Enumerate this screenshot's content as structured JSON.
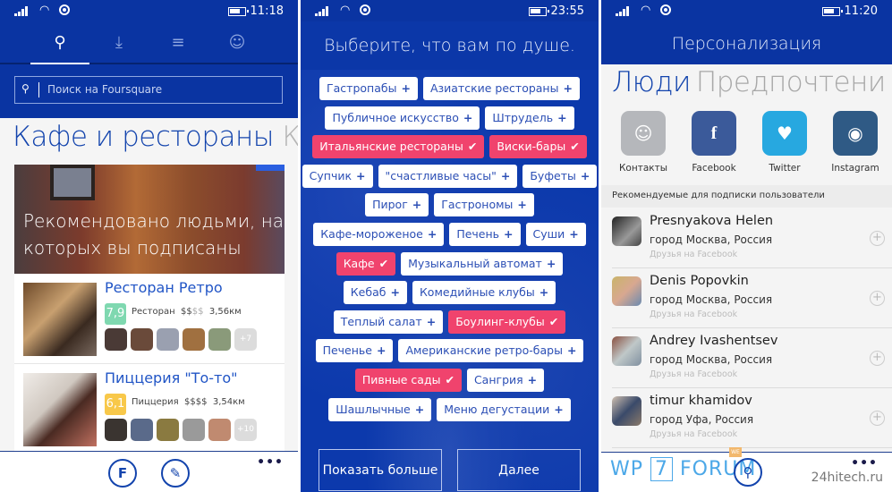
{
  "screen1": {
    "status": {
      "time": "11:18"
    },
    "tabs": [
      {
        "icon": "search-icon",
        "glyph": "⚲",
        "selected": true
      },
      {
        "icon": "download-icon",
        "glyph": "⤓",
        "selected": false
      },
      {
        "icon": "lists-icon",
        "glyph": "≡",
        "selected": false
      },
      {
        "icon": "profile-icon",
        "glyph": "☺",
        "selected": false
      }
    ],
    "search": {
      "placeholder": "Поиск на Foursquare"
    },
    "section_title": "Кафе и рестораны",
    "section_next": "К",
    "hero": {
      "text_line1": "Рекомендовано людьми, на",
      "text_line2": "которых вы подписаны"
    },
    "venues": [
      {
        "name": "Ресторан Ретро",
        "score": "7,9",
        "score_color": "#7fd8b0",
        "category": "Ресторан",
        "price": "$$",
        "price_dim": "$$",
        "distance": "3,56км",
        "more_friends": "+7"
      },
      {
        "name": "Пиццерия \"То-то\"",
        "score": "6,1",
        "score_color": "#f8c84a",
        "category": "Пиццерия",
        "price": "$$$$",
        "price_dim": "",
        "distance": "3,54км",
        "more_friends": "+10"
      }
    ],
    "appbar": {
      "more": "•••"
    }
  },
  "screen2": {
    "status": {
      "time": "23:55"
    },
    "title": "Выберите, что вам по душе.",
    "chip_rows": [
      [
        {
          "label": "Гастропабы",
          "selected": false
        },
        {
          "label": "Азиатские рестораны",
          "selected": false
        }
      ],
      [
        {
          "label": "Публичное искусство",
          "selected": false
        },
        {
          "label": "Штрудель",
          "selected": false
        }
      ],
      [
        {
          "label": "Итальянские рестораны",
          "selected": true
        },
        {
          "label": "Виски-бары",
          "selected": true
        }
      ],
      [
        {
          "label": "Супчик",
          "selected": false
        },
        {
          "label": "\"счастливые часы\"",
          "selected": false
        },
        {
          "label": "Буфеты",
          "selected": false
        }
      ],
      [
        {
          "label": "Пирог",
          "selected": false
        },
        {
          "label": "Гастрономы",
          "selected": false
        }
      ],
      [
        {
          "label": "Кафе-мороженое",
          "selected": false
        },
        {
          "label": "Печень",
          "selected": false
        },
        {
          "label": "Суши",
          "selected": false
        }
      ],
      [
        {
          "label": "Кафе",
          "selected": true
        },
        {
          "label": "Музыкальный автомат",
          "selected": false
        }
      ],
      [
        {
          "label": "Кебаб",
          "selected": false
        },
        {
          "label": "Комедийные клубы",
          "selected": false
        }
      ],
      [
        {
          "label": "Теплый салат",
          "selected": false
        },
        {
          "label": "Боулинг-клубы",
          "selected": true
        }
      ],
      [
        {
          "label": "Печенье",
          "selected": false
        },
        {
          "label": "Американские ретро-бары",
          "selected": false
        }
      ],
      [
        {
          "label": "Пивные сады",
          "selected": true
        },
        {
          "label": "Сангрия",
          "selected": false
        }
      ],
      [
        {
          "label": "Шашлычные",
          "selected": false
        },
        {
          "label": "Меню дегустации",
          "selected": false
        }
      ]
    ],
    "add_mark": "+",
    "selected_mark": "✔",
    "show_more": "Показать больше",
    "next": "Далее"
  },
  "screen3": {
    "status": {
      "time": "11:20"
    },
    "header": "Персонализация",
    "pivot_selected": "Люди",
    "pivot_next": "Предпочтени",
    "sources": [
      {
        "label": "Контакты",
        "icon": "contacts-icon",
        "glyph": "☺",
        "color": "#b5b7bb"
      },
      {
        "label": "Facebook",
        "icon": "facebook-icon",
        "glyph": "f",
        "color": "#3b5a9a"
      },
      {
        "label": "Twitter",
        "icon": "twitter-icon",
        "glyph": "♥",
        "color": "#27a8e0"
      },
      {
        "label": "Instagram",
        "icon": "instagram-icon",
        "glyph": "◉",
        "color": "#2f5a85"
      }
    ],
    "recommended_header": "Рекомендуемые для подписки пользователи",
    "people": [
      {
        "name": "Presnyakova Helen",
        "city": "город Москва, Россия",
        "source": "Друзья на Facebook"
      },
      {
        "name": "Denis Popovkin",
        "city": "город Москва, Россия",
        "source": "Друзья на Facebook"
      },
      {
        "name": "Andrey Ivashentsev",
        "city": "город Москва, Россия",
        "source": "Друзья на Facebook"
      },
      {
        "name": "timur khamidov",
        "city": "город Уфа, Россия",
        "source": "Друзья на Facebook"
      }
    ],
    "add_mark": "+",
    "appbar": {
      "more": "•••"
    },
    "watermark_left": {
      "a": "WP",
      "b": "7",
      "c": "FORUM",
      "tag": "WE"
    },
    "watermark_right": "24hitech.ru"
  }
}
